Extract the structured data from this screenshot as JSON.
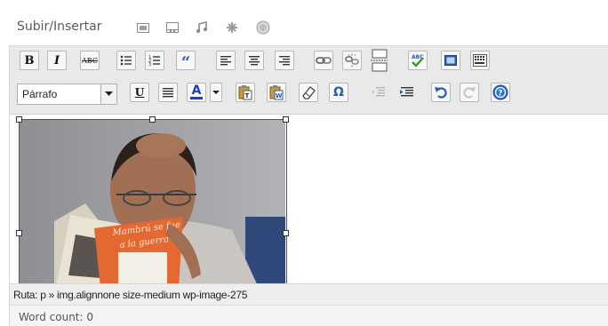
{
  "upload": {
    "label": "Subir/Insertar",
    "icons": [
      "image-icon",
      "video-icon",
      "audio-icon",
      "media-icon",
      "other-media-icon"
    ]
  },
  "toolbar": {
    "row1": [
      "bold-button",
      "italic-button",
      "strikethrough-button",
      "bullet-list-button",
      "numbered-list-button",
      "blockquote-button",
      "align-left-button",
      "align-center-button",
      "align-right-button",
      "insert-link-button",
      "unlink-button",
      "insert-more-button",
      "spellcheck-button",
      "fullscreen-button",
      "kitchen-sink-button"
    ],
    "bold_label": "B",
    "italic_label": "I",
    "strike_label": "ABC",
    "blockquote_label": "“",
    "format_select": {
      "value": "Párrafo"
    },
    "underline_label": "U",
    "text_color_label": "A",
    "text_color": "#1c3fbf",
    "special_char_label": "Ω",
    "row2": [
      "format-select",
      "underline-button",
      "justify-button",
      "text-color-button",
      "text-color-dropdown",
      "paste-text-button",
      "paste-word-button",
      "remove-format-button",
      "special-character-button",
      "outdent-button",
      "indent-button",
      "undo-button",
      "redo-button",
      "help-button"
    ]
  },
  "content": {
    "image": {
      "book_title_line1": "Mambrú se fue",
      "book_title_line2": "a la guerra"
    }
  },
  "status": {
    "path": "Ruta: p » img.alignnone size-medium wp-image-275",
    "word_count": "Word count: 0"
  },
  "colors": {
    "toolbar_bg": "#e9e9e9",
    "icon_blue": "#2a5db0",
    "help_blue": "#2b6fd6"
  }
}
